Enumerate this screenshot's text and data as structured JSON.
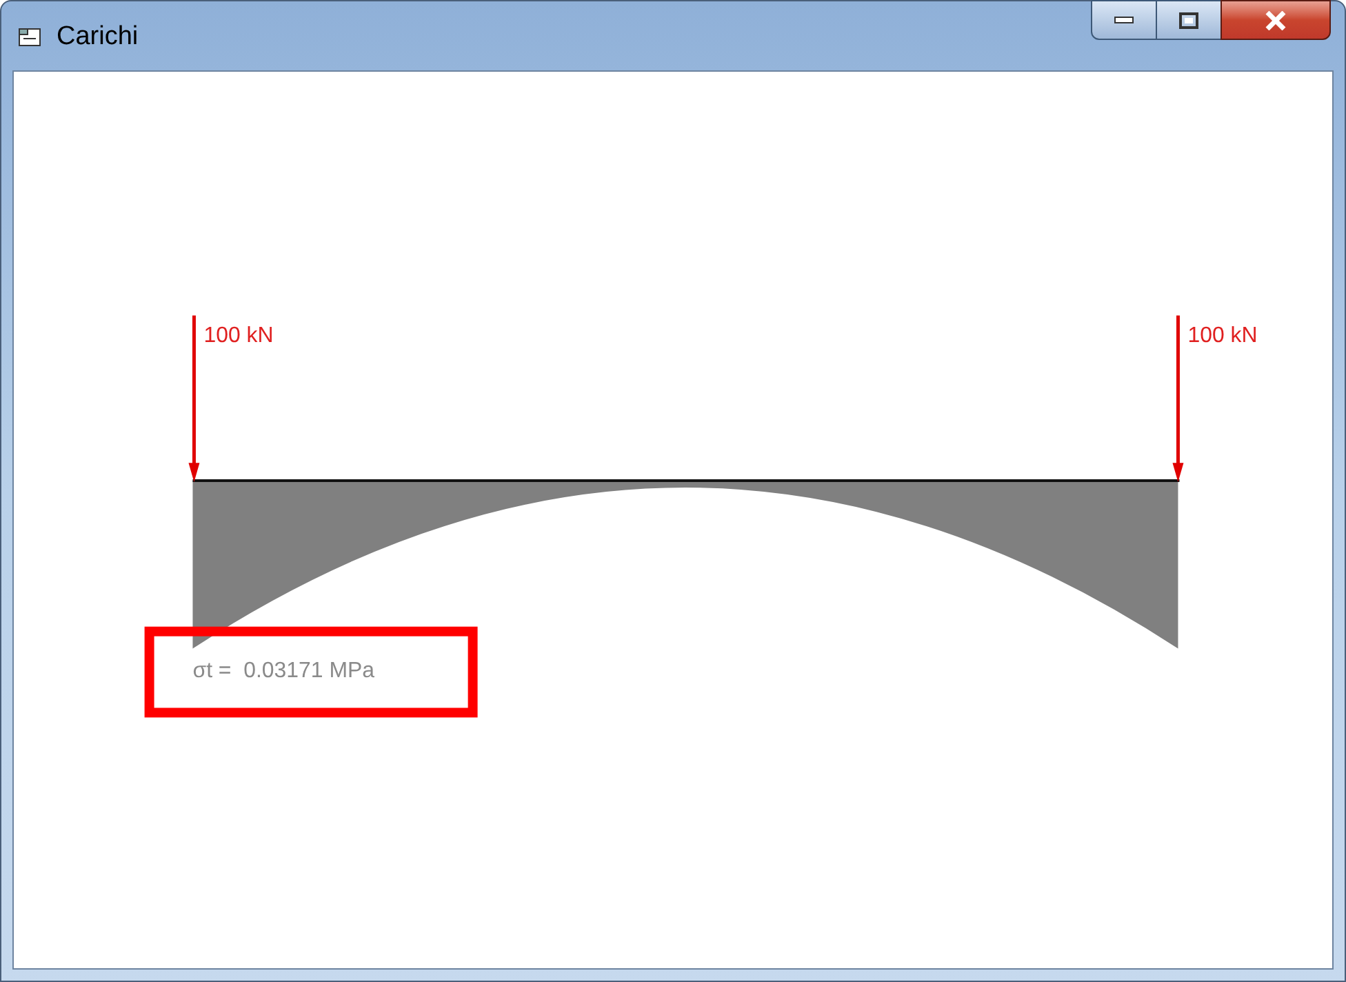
{
  "window": {
    "title": "Carichi"
  },
  "loads": [
    {
      "label": "100 kN"
    },
    {
      "label": "100 kN"
    }
  ],
  "result": {
    "text": "σt =  0.03171 MPa",
    "highlighted": true
  }
}
